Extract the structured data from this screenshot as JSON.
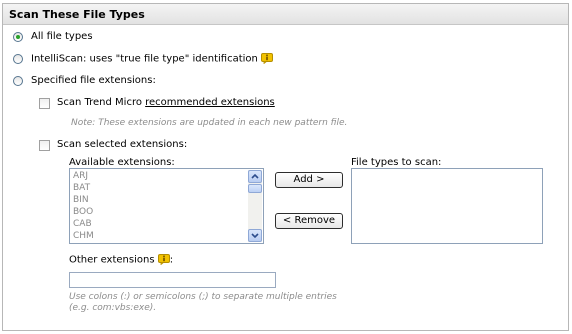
{
  "section": {
    "title": "Scan These File Types"
  },
  "options": {
    "all_files": "All file types",
    "intelliscan": "IntelliScan: uses \"true file type\" identification",
    "specified": "Specified file extensions:"
  },
  "recommended": {
    "prefix": "Scan Trend Micro ",
    "link": "recommended extensions",
    "note": "Note: These extensions are updated in each new pattern file."
  },
  "selected": {
    "label": "Scan selected extensions:",
    "available_label": "Available extensions:",
    "target_label": "File types to scan:",
    "available_items": [
      "ARJ",
      "BAT",
      "BIN",
      "BOO",
      "CAB",
      "CHM"
    ],
    "add_button": "Add >",
    "remove_button": "< Remove"
  },
  "other": {
    "label": "Other extensions",
    "colon": ":",
    "value": "",
    "hint_line1": "Use colons (:) or semicolons (;) to separate multiple entries",
    "hint_line2": "(e.g. com:vbs:exe)."
  },
  "colors": {
    "radio_selected": "#2aa22a",
    "tip_icon": "#f2c200"
  }
}
